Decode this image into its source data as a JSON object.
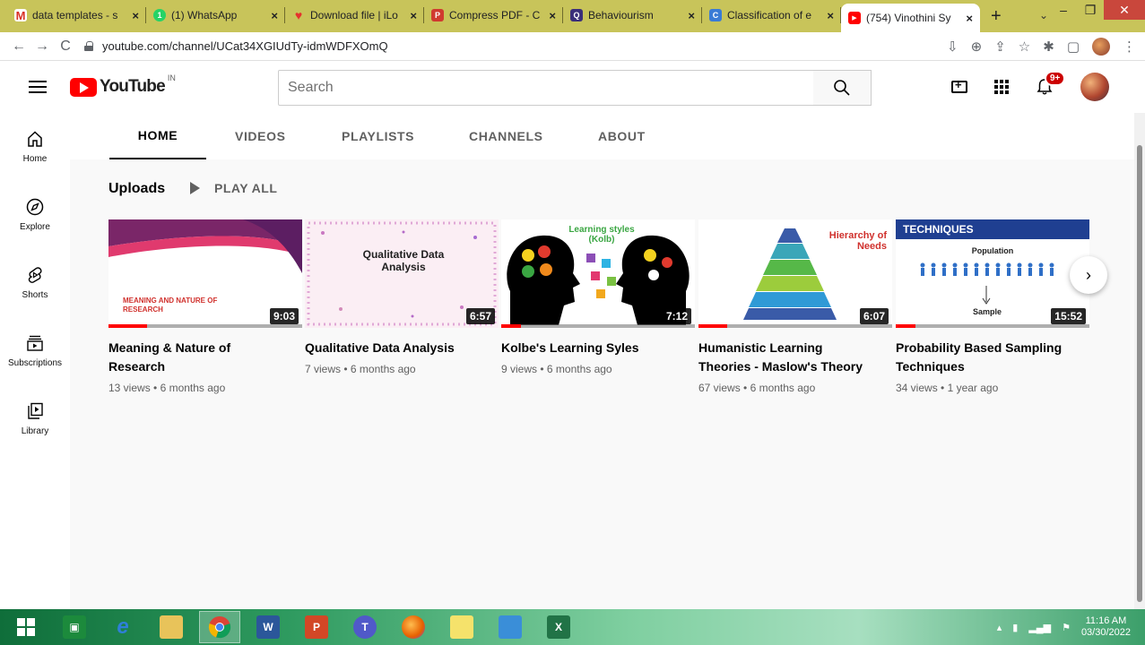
{
  "browser": {
    "tabs": [
      {
        "title": "data templates - s",
        "icon": "gmail-icon",
        "color": "#d93025",
        "glyph": "M"
      },
      {
        "title": "(1) WhatsApp",
        "icon": "whatsapp-icon",
        "color": "#25d366",
        "glyph": "1"
      },
      {
        "title": "Download file | iLo",
        "icon": "heart-icon",
        "color": "#e5322d",
        "glyph": "♥"
      },
      {
        "title": "Compress PDF - C",
        "icon": "pdf-icon",
        "color": "#d03a2f",
        "glyph": "P"
      },
      {
        "title": "Behaviourism",
        "icon": "quizlet-icon",
        "color": "#3b2f7a",
        "glyph": "Q"
      },
      {
        "title": "Classification of e",
        "icon": "classification-icon",
        "color": "#3a7bd5",
        "glyph": "C"
      },
      {
        "title": "(754) Vinothini Sy",
        "icon": "youtube-icon",
        "color": "#ff0000",
        "glyph": "▶"
      }
    ],
    "active_tab": 6,
    "url": "youtube.com/channel/UCat34XGIUdTy-idmWDFXOmQ"
  },
  "youtube": {
    "logo_text": "YouTube",
    "country": "IN",
    "search_placeholder": "Search",
    "notification_count": "9+"
  },
  "rail": [
    {
      "label": "Home",
      "icon": "home-icon"
    },
    {
      "label": "Explore",
      "icon": "compass-icon"
    },
    {
      "label": "Shorts",
      "icon": "shorts-icon"
    },
    {
      "label": "Subscriptions",
      "icon": "subscriptions-icon"
    },
    {
      "label": "Library",
      "icon": "library-icon"
    }
  ],
  "channel_tabs": [
    "HOME",
    "VIDEOS",
    "PLAYLISTS",
    "CHANNELS",
    "ABOUT"
  ],
  "active_channel_tab": 0,
  "shelf": {
    "title": "Uploads",
    "play_all": "PLAY ALL"
  },
  "videos": [
    {
      "title": "Meaning & Nature of Research",
      "views": "13 views",
      "age": "6 months ago",
      "duration": "9:03",
      "watched": 0.2,
      "thumb_text": "MEANING AND NATURE OF RESEARCH"
    },
    {
      "title": "Qualitative Data Analysis",
      "views": "7 views",
      "age": "6 months ago",
      "duration": "6:57",
      "watched": 0.0,
      "thumb_text": "Qualitative Data Analysis"
    },
    {
      "title": "Kolbe's Learning Syles",
      "views": "9 views",
      "age": "6 months ago",
      "duration": "7:12",
      "watched": 0.1,
      "thumb_text": "Learning styles (Kolb)"
    },
    {
      "title": "Humanistic Learning Theories - Maslow's Theory",
      "views": "67 views",
      "age": "6 months ago",
      "duration": "6:07",
      "watched": 0.15,
      "thumb_text": "Hierarchy of Needs"
    },
    {
      "title": "Probability Based Sampling Techniques",
      "views": "34 views",
      "age": "1 year ago",
      "duration": "15:52",
      "watched": 0.1,
      "thumb_text": "TECHNIQUES",
      "thumb_text_2": "Population",
      "thumb_text_3": "Sample"
    }
  ],
  "taskbar": {
    "time": "11:16 AM",
    "date": "03/30/2022"
  }
}
